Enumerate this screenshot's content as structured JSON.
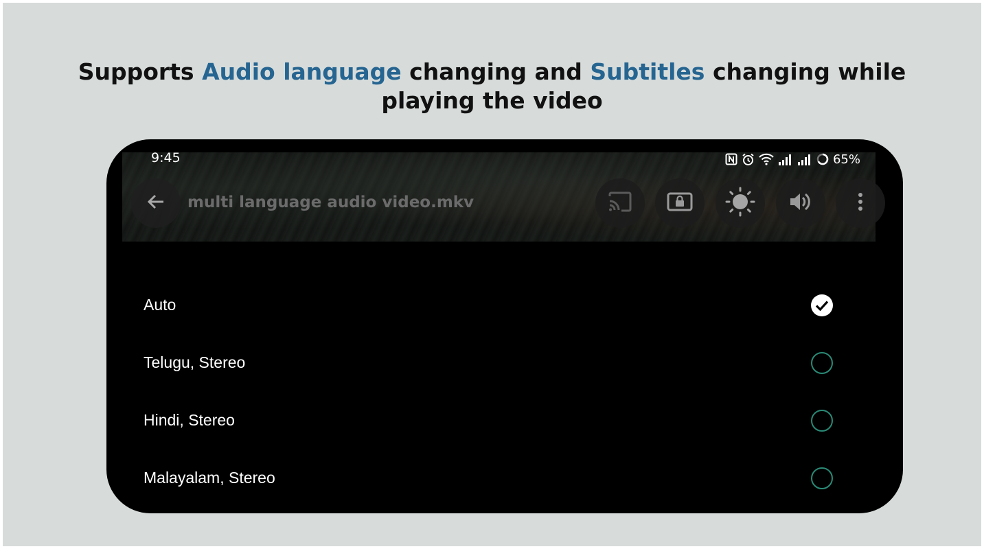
{
  "headline": {
    "part1": "Supports ",
    "highlight1": "Audio language",
    "part2": " changing and ",
    "highlight2": "Subtitles",
    "part3": " changing while",
    "line2": "playing the video"
  },
  "colors": {
    "highlight": "#266591",
    "radio_outline": "#2a8a76",
    "background_panel": "#d7dcdb"
  },
  "status_bar": {
    "time": "9:45",
    "battery": "65%",
    "icons": [
      "nfc-icon",
      "alarm-icon",
      "wifi-icon",
      "signal-icon",
      "signal-icon",
      "battery-ring-icon"
    ]
  },
  "toolbar": {
    "back_icon": "arrow-left-icon",
    "file_name": "multi language audio video.mkv",
    "buttons": [
      "cast-icon",
      "screen-lock-icon",
      "brightness-icon",
      "volume-icon",
      "more-vert-icon"
    ]
  },
  "audio_tracks": [
    {
      "label": "Auto",
      "selected": true
    },
    {
      "label": "Telugu, Stereo",
      "selected": false
    },
    {
      "label": "Hindi, Stereo",
      "selected": false
    },
    {
      "label": "Malayalam, Stereo",
      "selected": false
    }
  ]
}
